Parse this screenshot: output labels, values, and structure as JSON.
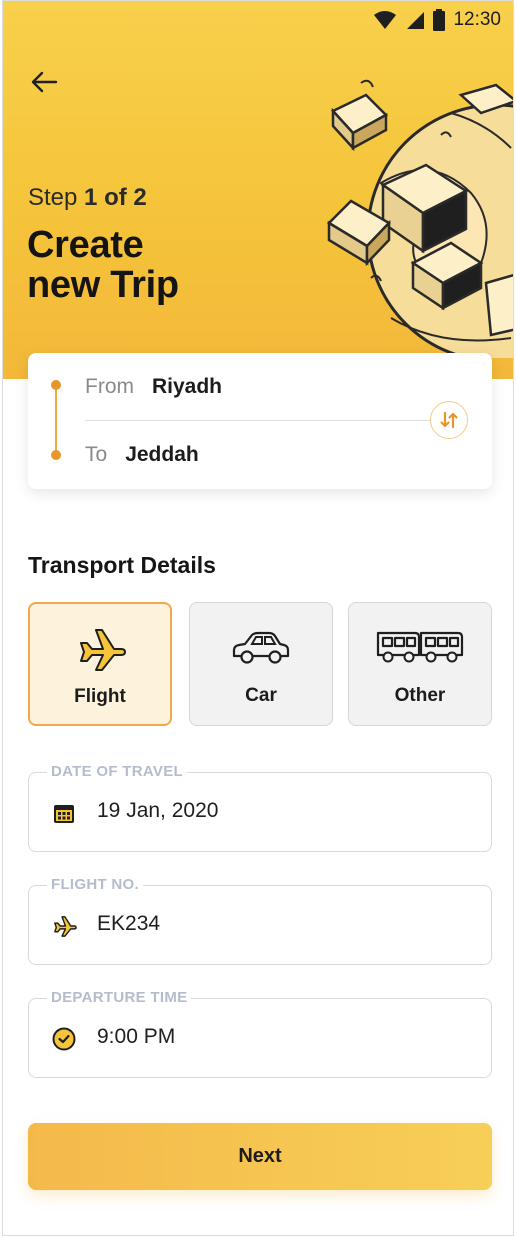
{
  "status_bar": {
    "time": "12:30"
  },
  "header": {
    "step_prefix": "Step",
    "step_value": "1 of 2",
    "title_line1": "Create",
    "title_line2": "new Trip"
  },
  "route": {
    "from_label": "From",
    "from_value": "Riyadh",
    "to_label": "To",
    "to_value": "Jeddah"
  },
  "transport": {
    "section_title": "Transport Details",
    "options": [
      {
        "label": "Flight",
        "icon": "airplane-icon",
        "selected": true
      },
      {
        "label": "Car",
        "icon": "car-icon",
        "selected": false
      },
      {
        "label": "Other",
        "icon": "bus-icon",
        "selected": false
      }
    ]
  },
  "fields": {
    "date": {
      "label": "DATE OF TRAVEL",
      "value": "19 Jan, 2020",
      "icon": "calendar-icon"
    },
    "flight_no": {
      "label": "FLIGHT NO.",
      "value": "EK234",
      "icon": "airplane-icon"
    },
    "departure": {
      "label": "DEPARTURE TIME",
      "value": "9:00 PM",
      "icon": "clock-icon"
    }
  },
  "actions": {
    "next_label": "Next"
  },
  "colors": {
    "accent": "#f5c43a",
    "accent_dark": "#e8952b",
    "selected_bg": "#fdf2db"
  }
}
